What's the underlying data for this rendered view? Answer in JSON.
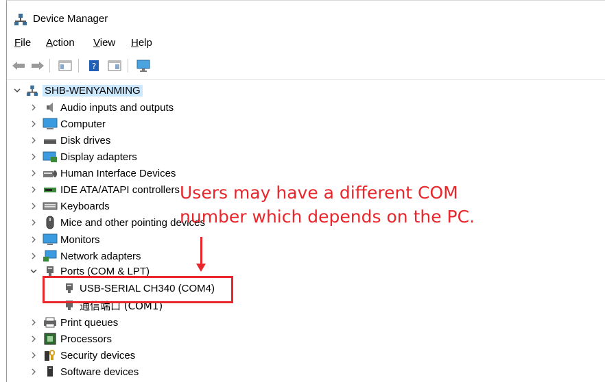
{
  "window": {
    "title": "Device Manager"
  },
  "menubar": {
    "items": [
      {
        "label": "File",
        "accel": "F",
        "rest": "ile"
      },
      {
        "label": "Action",
        "accel": "A",
        "rest": "ction"
      },
      {
        "label": "View",
        "accel": "V",
        "rest": "iew"
      },
      {
        "label": "Help",
        "accel": "H",
        "rest": "elp"
      }
    ]
  },
  "tree": {
    "root": "SHB-WENYANMING",
    "categories": [
      "Audio inputs and outputs",
      "Computer",
      "Disk drives",
      "Display adapters",
      "Human Interface Devices",
      "IDE ATA/ATAPI controllers",
      "Keyboards",
      "Mice and other pointing devices",
      "Monitors",
      "Network adapters",
      "Ports (COM & LPT)",
      "Print queues",
      "Processors",
      "Security devices",
      "Software devices"
    ],
    "ports_children": [
      "USB-SERIAL CH340 (COM4)",
      "通信端口 (COM1)"
    ]
  },
  "annotation": {
    "line1": "Users may have a different COM",
    "line2": "number which depends on the PC.",
    "color": "#e8262b"
  }
}
